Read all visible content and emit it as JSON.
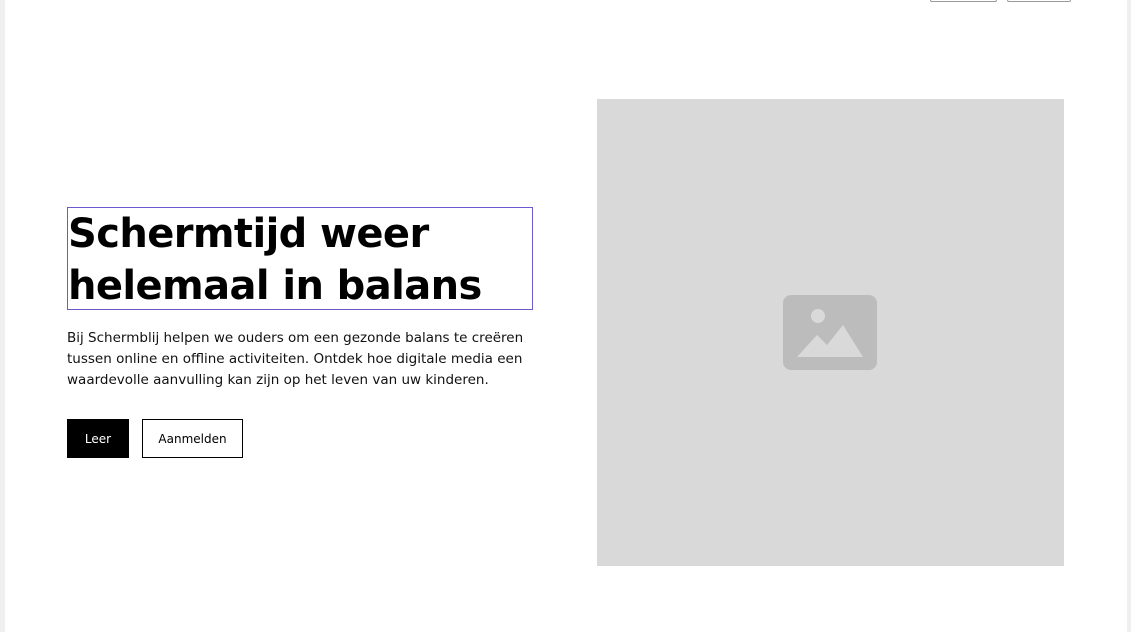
{
  "hero": {
    "headline_line1": "Schermtijd weer",
    "headline_line2": "helemaal in balans",
    "description": "Bij Schermblij helpen we ouders om een gezonde balans te creëren tussen online en offline activiteiten. Ontdek hoe digitale media een waardevolle aanvulling kan zijn op het leven van uw kinderen.",
    "primary_button": "Leer",
    "secondary_button": "Aanmelden"
  },
  "media": {
    "icon": "image-icon",
    "placeholder_color": "#d9d9d9",
    "icon_color": "#bcbcbc"
  },
  "colors": {
    "primary": "#000000",
    "background": "#ffffff",
    "focus_outline": "#6a5acd"
  }
}
